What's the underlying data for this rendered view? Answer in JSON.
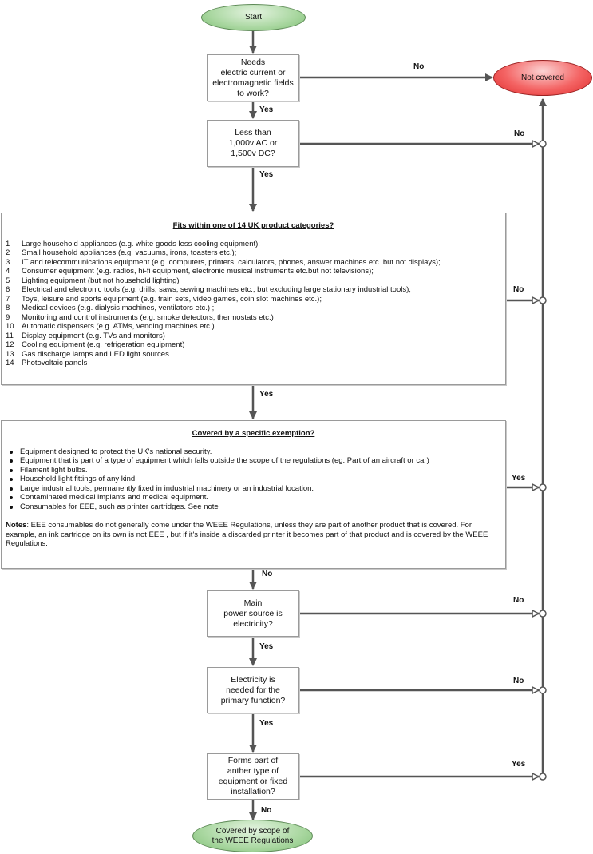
{
  "flowchart": {
    "start": "Start",
    "not_covered": "Not covered",
    "covered": "Covered by scope of\nthe WEEE Regulations",
    "q1": "Needs\nelectric current or\nelectromagnetic fields\nto work?",
    "q2": "Less than\n1,000v AC or\n1,500v DC?",
    "q3": {
      "title": "Fits within one of 14 UK product categories?",
      "categories": [
        {
          "num": "1",
          "text": "Large household appliances (e.g. white goods less cooling equipment);"
        },
        {
          "num": "2",
          "text": "Small household appliances (e.g. vacuums, irons, toasters etc.);"
        },
        {
          "num": "3",
          "text": "IT and telecommunications equipment (e.g. computers, printers, calculators, phones, answer machines etc. but not displays);"
        },
        {
          "num": "4",
          "text": "Consumer equipment (e.g. radios, hi-fi equipment, electronic musical instruments etc.but not televisions);"
        },
        {
          "num": "5",
          "text": "Lighting equipment (but not household lighting)"
        },
        {
          "num": "6",
          "text": "Electrical and electronic tools (e.g. drills, saws, sewing machines etc., but excluding large stationary industrial tools);"
        },
        {
          "num": "7",
          "text": "Toys, leisure and sports equipment (e.g. train sets, video games, coin slot machines etc.);"
        },
        {
          "num": "8",
          "text": "Medical devices (e.g. dialysis machines, ventilators etc.) ;"
        },
        {
          "num": "9",
          "text": "Monitoring and control instruments (e.g. smoke detectors, thermostats etc.)"
        },
        {
          "num": "10",
          "text": "Automatic dispensers (e.g. ATMs, vending machines etc.)."
        },
        {
          "num": "11",
          "text": "Display equipment (e.g. TVs and monitors)"
        },
        {
          "num": "12",
          "text": "Cooling equipment (e.g. refrigeration equipment)"
        },
        {
          "num": "13",
          "text": "Gas discharge lamps and LED light sources"
        },
        {
          "num": "14",
          "text": "Photovoltaic panels"
        }
      ]
    },
    "q4": {
      "title": "Covered by a specific exemption?",
      "exemptions": [
        "Equipment designed to protect the UK's national security.",
        "Equipment that is part of a type of equipment which falls outside the scope of the regulations (eg. Part of an aircraft or car)",
        "Filament light bulbs.",
        "Household light fittings of any kind.",
        "Large industrial tools, permanently fixed in industrial machinery or an industrial location.",
        "Contaminated medical implants and medical equipment.",
        "Consumables for EEE, such as printer cartridges. See note"
      ],
      "notes_label": "Notes",
      "notes_text": ": EEE consumables do not generally come under the WEEE Regulations, unless they are part of another product that is covered. For example, an ink cartridge on its own is not EEE , but if it's inside a discarded printer it becomes part of that product and is covered by the WEEE Regulations."
    },
    "q5": "Main\npower source is\nelectricity?",
    "q6": "Electricity is\nneeded for the\nprimary function?",
    "q7": "Forms part of\nanther type of\nequipment or fixed\ninstallation?",
    "labels": {
      "q1_no": "No",
      "q1_yes": "Yes",
      "q2_no": "No",
      "q2_yes": "Yes",
      "q3_no": "No",
      "q3_yes": "Yes",
      "q4_yes": "Yes",
      "q4_no": "No",
      "q5_no": "No",
      "q5_yes": "Yes",
      "q6_no": "No",
      "q6_yes": "Yes",
      "q7_yes": "Yes",
      "q7_no": "No"
    },
    "colors": {
      "line": "#555555",
      "start_fill": "#a9d7a0",
      "end_fill": "#f46464"
    }
  }
}
